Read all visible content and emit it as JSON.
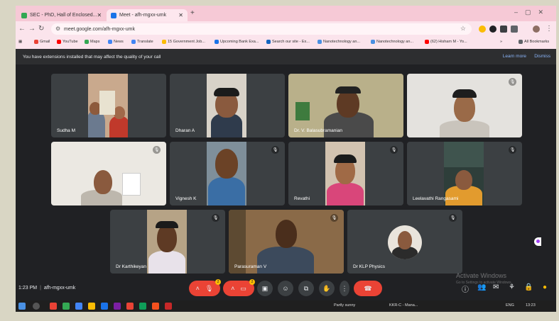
{
  "tabs": [
    {
      "label": "SEC - PhD, Hall of Enclosed...",
      "favicon_color": "#34a853"
    },
    {
      "label": "Meet - afh-mgxx-umk",
      "favicon_color": "#1a73e8"
    }
  ],
  "address": {
    "url": "meet.google.com/afh-mgxx-umk"
  },
  "bookmarks": [
    {
      "label": "Gmail",
      "color": "#ea4335"
    },
    {
      "label": "YouTube",
      "color": "#ff0000"
    },
    {
      "label": "Maps",
      "color": "#34a853"
    },
    {
      "label": "News",
      "color": "#4285f4"
    },
    {
      "label": "Translate",
      "color": "#4285f4"
    },
    {
      "label": "15 Government Job...",
      "color": "#fbbc04"
    },
    {
      "label": "Upcoming Bank Exa...",
      "color": "#1a73e8"
    },
    {
      "label": "Search our site - Ex...",
      "color": "#1565c0"
    },
    {
      "label": "Nanotechnology an...",
      "color": "#4a90e2"
    },
    {
      "label": "Nanotechnology an...",
      "color": "#4a90e2"
    },
    {
      "label": "(62) Hisham M - Yo...",
      "color": "#ff0000"
    }
  ],
  "all_bookmarks": "All Bookmarks",
  "notice": {
    "text": "You have extensions installed that may affect the quality of your call",
    "learn_more": "Learn more",
    "dismiss": "Dismiss"
  },
  "participants": [
    {
      "name": "Sudha M"
    },
    {
      "name": "Dharan A"
    },
    {
      "name": "Dr. V. Balasubramanian"
    },
    {
      "name": ""
    },
    {
      "name": ""
    },
    {
      "name": "Vignesh K"
    },
    {
      "name": "Revathi"
    },
    {
      "name": "Leelavathi Rangasami"
    },
    {
      "name": "Dr Karthikeyan"
    },
    {
      "name": "Parasuraman V"
    },
    {
      "name": "Dr KLP Physics"
    }
  ],
  "meeting": {
    "time": "1:23 PM",
    "separator": "|",
    "code": "afh-mgxx-umk"
  },
  "controls": {
    "mic_badge": "2",
    "cam_badge": "2"
  },
  "watermark": {
    "title": "Activate Windows",
    "subtitle": "Go to Settings to activate Windows."
  },
  "taskbar": {
    "weather": "Partly sunny",
    "news": "KKR-C - Mana...",
    "lang": "ENG",
    "clock": "13:23"
  },
  "colors": {
    "meet_bg": "#202124",
    "tile_bg": "#3c4043",
    "end_call": "#ea4335",
    "accent_link": "#8ab4f8"
  },
  "icons": [
    "mic-off-icon",
    "camera-off-icon",
    "captions-icon",
    "emoji-icon",
    "present-icon",
    "hand-icon",
    "more-icon",
    "end-call-icon",
    "info-icon",
    "people-icon",
    "chat-icon",
    "activities-icon",
    "lock-icon"
  ]
}
